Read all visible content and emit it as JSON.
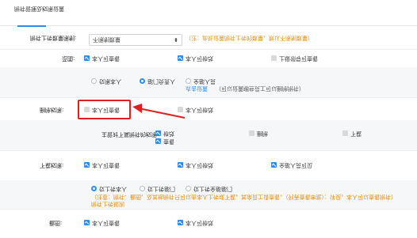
{
  "rows": {
    "r1": {
      "label": "截图:",
      "options": [
        "本人可查看",
        "本人可修改"
      ]
    },
    "r2": {
      "title": "附件上传规则",
      "note": "（注意：附件、截图、及其他附件只可以由本人上传或下载，其余员工请查看，（列表查看审批）：详见，本人可以查看附件）",
      "radios": [
        "仅上传本人",
        "仅上传部门",
        "仅上传全部部门"
      ]
    },
    "r3": {
      "label": "下载权限:",
      "options": [
        "本人可查看",
        "本人可修改",
        "全部人员可见"
      ]
    },
    "r4": {
      "label": "主管对下属附件的权限:",
      "group": [
        "查看",
        "修改"
      ],
      "extra": [
        "删除",
        "下载"
      ]
    },
    "r5": {
      "label": "删除权限:",
      "options": [
        "本人可查看",
        "本人可修改"
      ]
    },
    "r6": {
      "radios": [
        "仅限本人",
        "部门负责人",
        "全部人员"
      ],
      "link": "点击设置",
      "note": "（可以设置哪些员工可以删除附件）"
    },
    "r7": {
      "label": "范围:",
      "options": [
        "本人可查看",
        "本人可修改",
        "上级领导可查看"
      ]
    },
    "r8": {
      "label": "附件上传数量限制:",
      "select_value": "不限制数量",
      "note": "（注：此处设置附件上传的数量，默认不限制数量）"
    }
  },
  "footer_tab": {
    "label": "附件管理及权限设置"
  },
  "colors": {
    "accent": "#2d8cf0",
    "note": "#e68a00",
    "highlight": "#e02020"
  }
}
